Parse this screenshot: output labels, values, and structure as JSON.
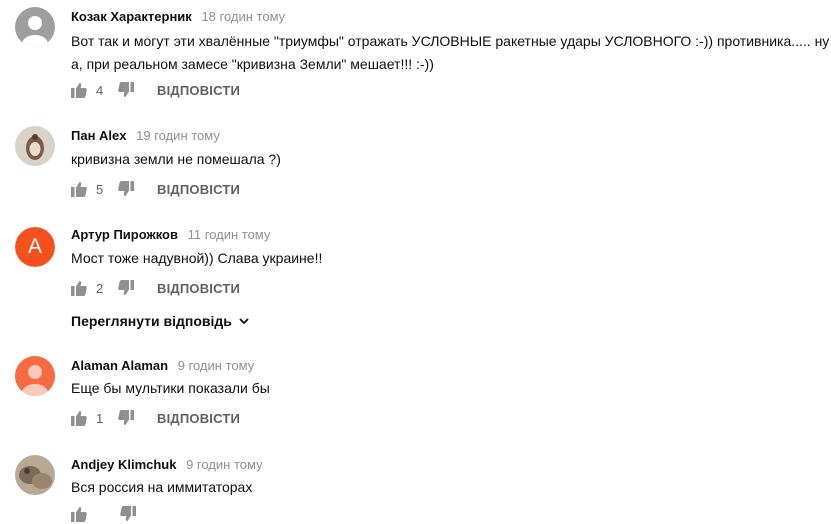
{
  "comments": [
    {
      "author": "Козак Характерник",
      "time": "18 годин тому",
      "text_line1": "Вот так и могут эти хвалённые \"триумфы\" отражать УСЛОВНЫЕ ракетные удары УСЛОВНОГО :-)) противника..... ну",
      "text_line2": "а, при реальном замесе \"кривизна Земли\" мешает!!! :-))",
      "likes": "4",
      "reply": "ВІДПОВІСТИ",
      "avatar": "default-avatar-gray"
    },
    {
      "author": "Пан Alex",
      "time": "19 годин тому",
      "text_line1": "кривизна земли не помешала ?)",
      "likes": "5",
      "reply": "ВІДПОВІСТИ",
      "avatar": "photo-avatar"
    },
    {
      "author": "Артур Пирожков",
      "time": "11 годин тому",
      "text_line1": "Мост тоже надувной)) Слава украине!!",
      "likes": "2",
      "reply": "ВІДПОВІСТИ",
      "avatar_letter": "А",
      "avatar_color": "#f4511e"
    },
    {
      "author": "Alaman Alaman",
      "time": "9 годин тому",
      "text_line1": "Еще бы мультики показали бы",
      "likes": "1",
      "reply": "ВІДПОВІСТИ",
      "avatar": "default-avatar-orange"
    },
    {
      "author": "Andjey Klimchuk",
      "time": "9 годин тому",
      "text_line1": "Вся россия на иммитаторах",
      "avatar": "photo-avatar"
    }
  ],
  "view_replies_label": "Переглянути відповідь",
  "colors": {
    "secondary_text": "#606060",
    "timestamp": "#909090",
    "orange_avatar": "#f4511e",
    "gray_avatar": "#9e9e9e"
  }
}
